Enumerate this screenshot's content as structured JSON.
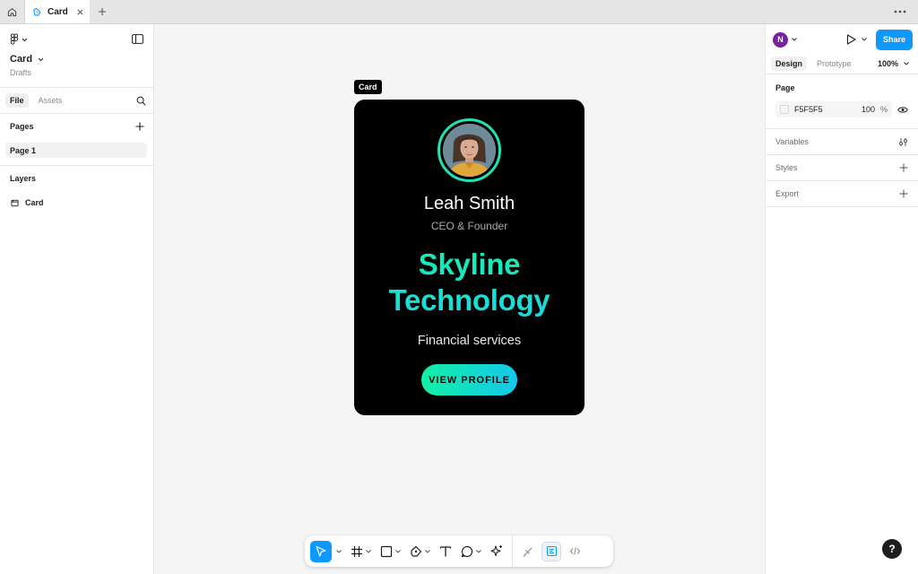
{
  "tabbar": {
    "tab_label": "Card"
  },
  "left_panel": {
    "file_name": "Card",
    "location": "Drafts",
    "tabs": [
      {
        "label": "File",
        "active": true
      },
      {
        "label": "Assets",
        "active": false
      }
    ],
    "pages_title": "Pages",
    "pages": [
      "Page 1"
    ],
    "layers_title": "Layers",
    "layers": [
      "Card"
    ]
  },
  "canvas": {
    "frame_label": "Card",
    "card": {
      "name": "Leah Smith",
      "role": "CEO & Founder",
      "company_line1": "Skyline",
      "company_line2": "Technology",
      "industry": "Financial services",
      "button_label": "VIEW PROFILE"
    }
  },
  "right_panel": {
    "user_initial": "N",
    "share_label": "Share",
    "tabs": [
      {
        "label": "Design",
        "active": true
      },
      {
        "label": "Prototype",
        "active": false
      }
    ],
    "zoom": "100%",
    "page_section": {
      "title": "Page",
      "fill_hex": "F5F5F5",
      "fill_opacity": "100",
      "fill_unit": "%"
    },
    "variables_title": "Variables",
    "styles_title": "Styles",
    "export_title": "Export"
  },
  "help_label": "?",
  "colors": {
    "accent": "#0d99ff",
    "card_bg": "#000000",
    "gradient_start": "#12f0a4",
    "gradient_end": "#13c8ec",
    "canvas_bg": "#f5f5f5"
  }
}
